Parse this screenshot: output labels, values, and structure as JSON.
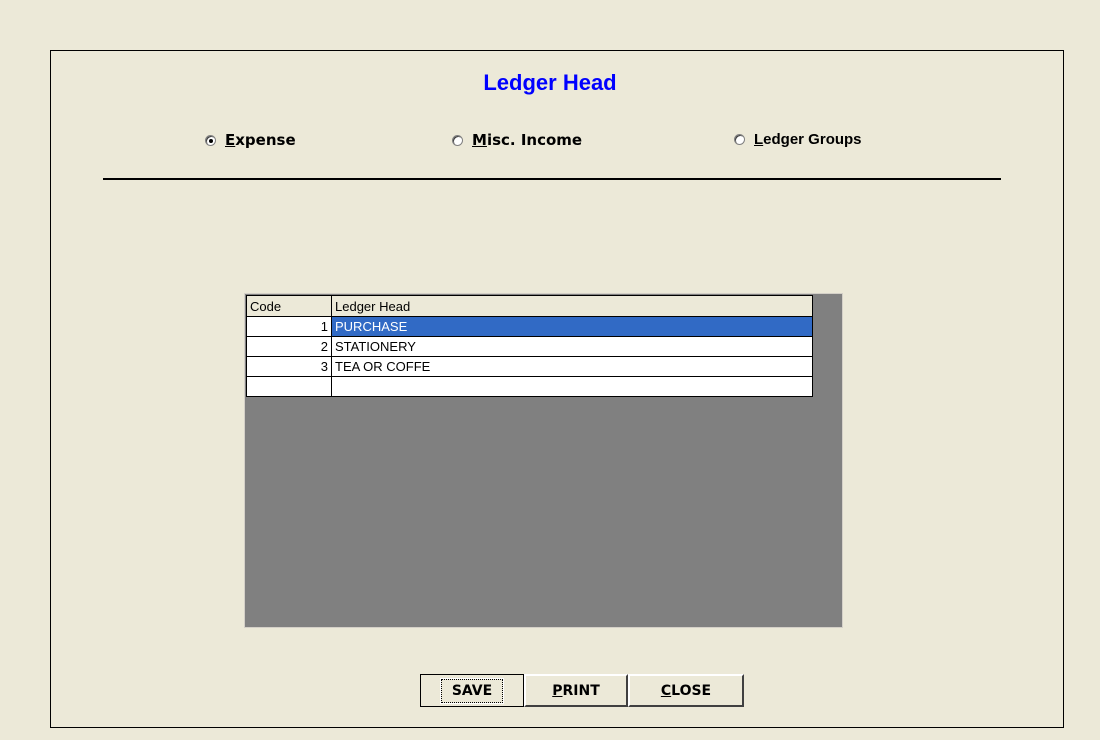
{
  "form": {
    "title": "Ledger Head",
    "options": [
      {
        "label": "Expense",
        "checked": true
      },
      {
        "label": "Misc. Income",
        "checked": false
      },
      {
        "label": "Ledger Groups",
        "checked": false
      }
    ]
  },
  "grid": {
    "columns": [
      "Code",
      "Ledger Head"
    ],
    "rows": [
      {
        "code": "1",
        "head": "PURCHASE",
        "selected": true
      },
      {
        "code": "2",
        "head": "STATIONERY",
        "selected": false
      },
      {
        "code": "3",
        "head": "TEA OR COFFE",
        "selected": false
      },
      {
        "code": "",
        "head": "",
        "selected": false
      }
    ]
  },
  "buttons": {
    "save": "SAVE",
    "print": "PRINT",
    "close": "CLOSE"
  },
  "colors": {
    "title": "#0000ff",
    "selection": "#316ac5",
    "background": "#ece9d8",
    "grid_bg": "#808080"
  }
}
